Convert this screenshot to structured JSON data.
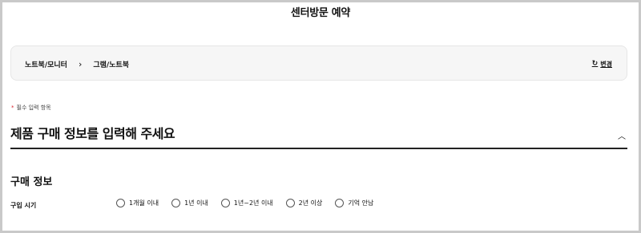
{
  "page": {
    "title": "센터방문 예약"
  },
  "category": {
    "breadcrumb": [
      "노트북/모니터",
      "그램/노트북"
    ],
    "separator": "›",
    "change_label": "변경",
    "change_icon": "refresh-icon"
  },
  "required_note": {
    "star": "*",
    "text": "필수 입력 항목"
  },
  "section": {
    "title": "제품 구매 정보를 입력해 주세요",
    "collapse_icon": "chevron-up-icon"
  },
  "purchase": {
    "title": "구매 정보",
    "period_label": "구입 시기",
    "options": [
      "1개월 이내",
      "1년 이내",
      "1년~2년 이내",
      "2년 이상",
      "기억 안남"
    ]
  }
}
